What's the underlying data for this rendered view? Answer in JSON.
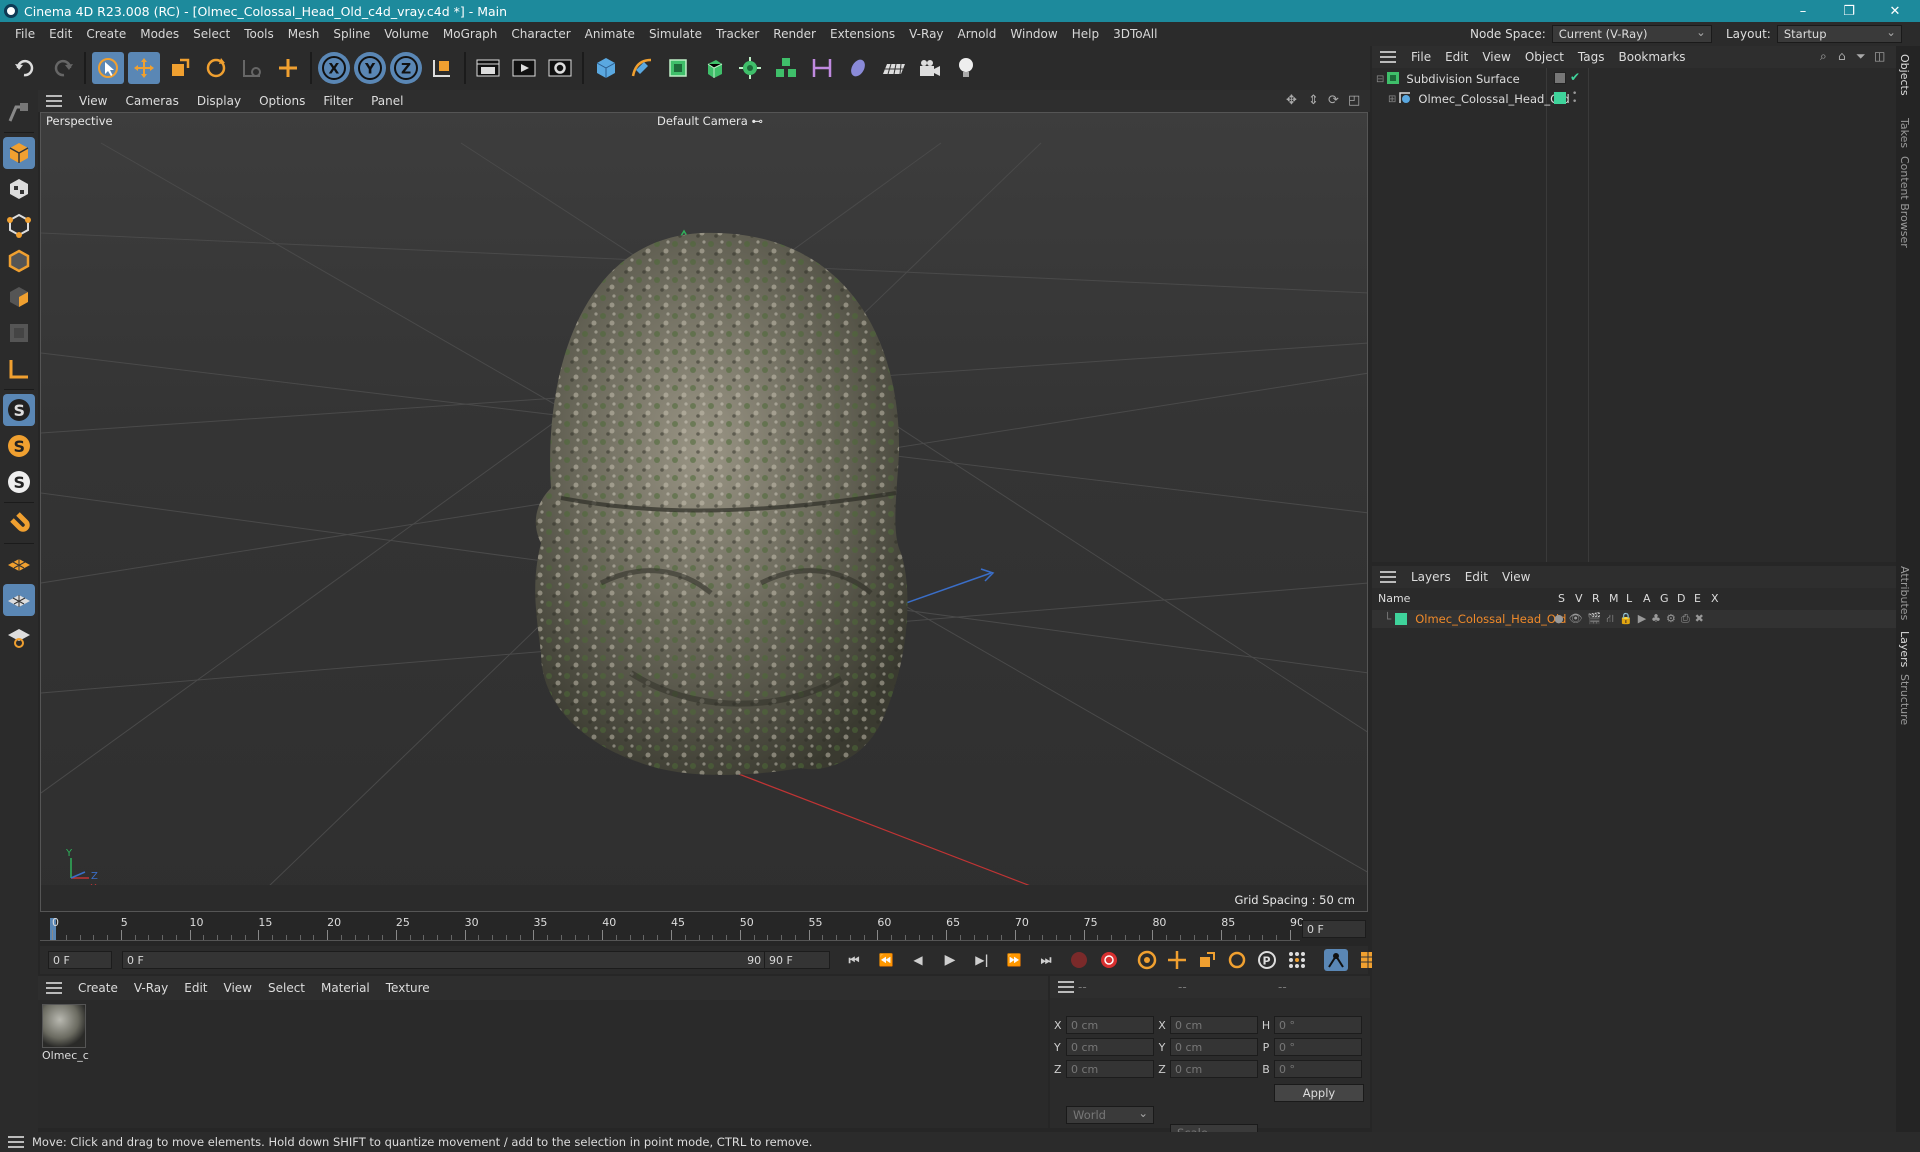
{
  "window": {
    "title": "Cinema 4D R23.008 (RC) - [Olmec_Colossal_Head_Old_c4d_vray.c4d *] - Main",
    "minimize": "–",
    "maximize": "❐",
    "close": "✕"
  },
  "menu": {
    "items": [
      "File",
      "Edit",
      "Create",
      "Modes",
      "Select",
      "Tools",
      "Mesh",
      "Spline",
      "Volume",
      "MoGraph",
      "Character",
      "Animate",
      "Simulate",
      "Tracker",
      "Render",
      "Extensions",
      "V-Ray",
      "Arnold",
      "Window",
      "Help",
      "3DToAll"
    ],
    "node_space_label": "Node Space:",
    "node_space_value": "Current (V-Ray)",
    "layout_label": "Layout:",
    "layout_value": "Startup"
  },
  "viewport": {
    "menu": [
      "View",
      "Cameras",
      "Display",
      "Options",
      "Filter",
      "Panel"
    ],
    "label": "Perspective",
    "camera": "Default Camera",
    "grid_spacing": "Grid Spacing : 50 cm",
    "axis_y": "Y",
    "axis_x": "X",
    "axis_z": "Z"
  },
  "timeline": {
    "ticks": [
      "0",
      "5",
      "10",
      "15",
      "20",
      "25",
      "30",
      "35",
      "40",
      "45",
      "50",
      "55",
      "60",
      "65",
      "70",
      "75",
      "80",
      "85",
      "90"
    ],
    "current_frame": "0 F",
    "start_field": "0 F",
    "range_start": "0 F",
    "range_end": "90 F",
    "end_field": "90 F"
  },
  "objects_panel": {
    "menu": [
      "File",
      "Edit",
      "View",
      "Object",
      "Tags",
      "Bookmarks"
    ],
    "items": [
      {
        "name": "Subdivision Surface"
      },
      {
        "name": "Olmec_Colossal_Head_Old"
      }
    ]
  },
  "layers_panel": {
    "menu": [
      "Layers",
      "Edit",
      "View"
    ],
    "columns": [
      "Name",
      "S",
      "V",
      "R",
      "M",
      "L",
      "A",
      "G",
      "D",
      "E",
      "X"
    ],
    "rows": [
      {
        "name": "Olmec_Colossal_Head_Old",
        "color": "#3fd39b"
      }
    ]
  },
  "material_panel": {
    "menu": [
      "Create",
      "V-Ray",
      "Edit",
      "View",
      "Select",
      "Material",
      "Texture"
    ],
    "materials": [
      {
        "name": "Olmec_c"
      }
    ]
  },
  "coords_panel": {
    "header": [
      "--",
      "--",
      "--"
    ],
    "rows": [
      {
        "l1": "X",
        "v1": "0 cm",
        "l2": "X",
        "v2": "0 cm",
        "l3": "H",
        "v3": "0 °"
      },
      {
        "l1": "Y",
        "v1": "0 cm",
        "l2": "Y",
        "v2": "0 cm",
        "l3": "P",
        "v3": "0 °"
      },
      {
        "l1": "Z",
        "v1": "0 cm",
        "l2": "Z",
        "v2": "0 cm",
        "l3": "B",
        "v3": "0 °"
      }
    ],
    "world": "World",
    "scale": "Scale",
    "apply": "Apply"
  },
  "side_tabs": [
    "Objects",
    "Takes",
    "Content Browser",
    "Attributes",
    "Layers",
    "Structure"
  ],
  "status": "Move: Click and drag to move elements. Hold down SHIFT to quantize movement / add to the selection in point mode, CTRL to remove."
}
